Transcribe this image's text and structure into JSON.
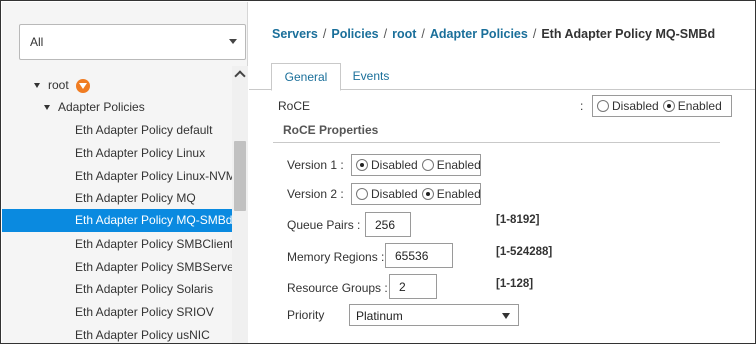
{
  "filter": {
    "value": "All"
  },
  "tree": {
    "items": [
      {
        "label": "root",
        "level": 0,
        "expanded": true
      },
      {
        "label": "Adapter Policies",
        "level": 1,
        "expanded": true
      },
      {
        "label": "Eth Adapter Policy default",
        "level": 2
      },
      {
        "label": "Eth Adapter Policy Linux",
        "level": 2
      },
      {
        "label": "Eth Adapter Policy Linux-NVMe",
        "level": 2
      },
      {
        "label": "Eth Adapter Policy MQ",
        "level": 2
      },
      {
        "label": "Eth Adapter Policy MQ-SMBd",
        "level": 2,
        "selected": true
      },
      {
        "label": "Eth Adapter Policy SMBClient",
        "level": 2
      },
      {
        "label": "Eth Adapter Policy SMBServer",
        "level": 2
      },
      {
        "label": "Eth Adapter Policy Solaris",
        "level": 2
      },
      {
        "label": "Eth Adapter Policy SRIOV",
        "level": 2
      },
      {
        "label": "Eth Adapter Policy usNIC",
        "level": 2
      }
    ]
  },
  "breadcrumb": {
    "items": [
      "Servers",
      "Policies",
      "root",
      "Adapter Policies"
    ],
    "separator": "/",
    "current": "Eth Adapter Policy MQ-SMBd"
  },
  "tabs": {
    "general": "General",
    "events": "Events",
    "active": "General"
  },
  "roce": {
    "label": "RoCE",
    "colon": ":",
    "options": {
      "disabled": "Disabled",
      "enabled": "Enabled"
    },
    "selected": "Enabled"
  },
  "roce_properties": {
    "title": "RoCE Properties",
    "version1": {
      "label": "Version 1 :",
      "selected": "Disabled"
    },
    "version2": {
      "label": "Version 2 :",
      "selected": "Enabled"
    },
    "options": {
      "disabled": "Disabled",
      "enabled": "Enabled"
    },
    "queue_pairs": {
      "label": "Queue Pairs :",
      "value": "256",
      "range": "[1-8192]"
    },
    "memory_regions": {
      "label": "Memory Regions :",
      "value": "65536",
      "range": "[1-524288]"
    },
    "resource_groups": {
      "label": "Resource Groups :",
      "value": "2",
      "range": "[1-128]"
    },
    "priority": {
      "label": "Priority",
      "value": "Platinum"
    }
  },
  "colors": {
    "accent": "#0a8ae0",
    "link": "#1a6f9a",
    "org_badge": "#f07c22"
  }
}
